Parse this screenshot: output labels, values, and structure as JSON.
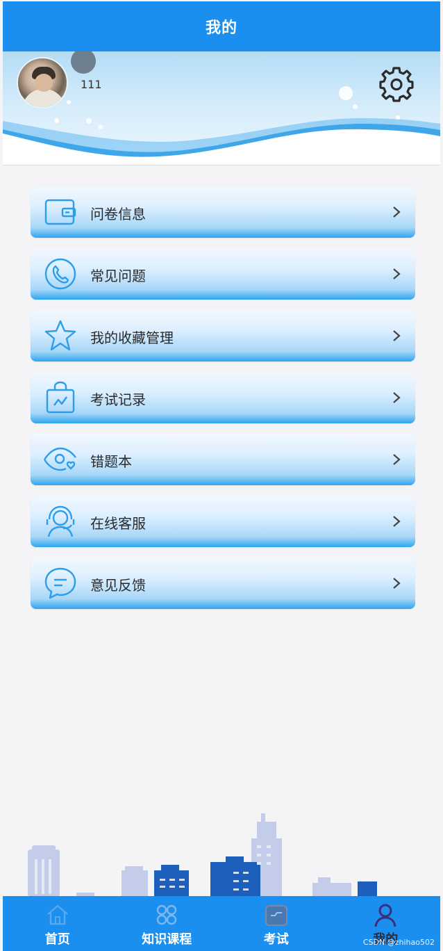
{
  "header": {
    "title": "我的"
  },
  "profile": {
    "username": "111",
    "avatar_icon": "user-photo",
    "settings_icon": "gear-icon"
  },
  "menu": [
    {
      "label": "问卷信息",
      "icon": "wallet-icon"
    },
    {
      "label": "常见问题",
      "icon": "phone-icon"
    },
    {
      "label": "我的收藏管理",
      "icon": "star-icon"
    },
    {
      "label": "考试记录",
      "icon": "bag-chart-icon"
    },
    {
      "label": "错题本",
      "icon": "eye-heart-icon"
    },
    {
      "label": "在线客服",
      "icon": "headset-icon"
    },
    {
      "label": "意见反馈",
      "icon": "chat-bubble-icon"
    }
  ],
  "tabbar": [
    {
      "label": "首页",
      "icon": "home-icon",
      "active": false
    },
    {
      "label": "知识课程",
      "icon": "grid-clover-icon",
      "active": false
    },
    {
      "label": "考试",
      "icon": "exam-icon",
      "active": false
    },
    {
      "label": "我的",
      "icon": "user-icon",
      "active": true
    }
  ],
  "watermark": "CSDN @zhihao502",
  "colors": {
    "primary": "#1a8ff0",
    "menu_icon": "#2e9de8",
    "background": "#f4f4f6"
  }
}
